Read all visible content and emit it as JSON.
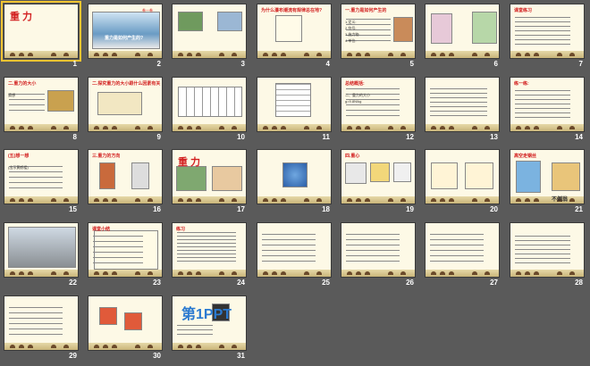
{
  "slides": [
    {
      "number": "1",
      "texts": [
        "重 力"
      ]
    },
    {
      "number": "2",
      "texts": [
        "重力是如何产生的?",
        "卷一卷"
      ]
    },
    {
      "number": "3",
      "texts": []
    },
    {
      "number": "4",
      "texts": [
        "为什么瀑布潮流有规律总在地?"
      ]
    },
    {
      "number": "5",
      "texts": [
        "一.重力是如何产生的",
        "1.定义:",
        "2.符号:",
        "3.施力物:",
        "4.单位:"
      ]
    },
    {
      "number": "6",
      "texts": []
    },
    {
      "number": "7",
      "texts": [
        "课堂练习"
      ]
    },
    {
      "number": "8",
      "texts": [
        "二.重力的大小",
        "猜想"
      ]
    },
    {
      "number": "9",
      "texts": [
        "二.探究重力的大小跟什么因素有关"
      ]
    },
    {
      "number": "10",
      "texts": []
    },
    {
      "number": "11",
      "texts": []
    },
    {
      "number": "12",
      "texts": [
        "总结概括:",
        "二、重力的大小",
        "g=9.8N/kg"
      ]
    },
    {
      "number": "13",
      "texts": []
    },
    {
      "number": "14",
      "texts": [
        "练一练:"
      ]
    },
    {
      "number": "15",
      "texts": [
        "(五)想一想",
        "(出示黄鹤楼)"
      ]
    },
    {
      "number": "16",
      "texts": [
        "三.重力的方向"
      ]
    },
    {
      "number": "17",
      "texts": [
        "重 力"
      ]
    },
    {
      "number": "18",
      "texts": []
    },
    {
      "number": "19",
      "texts": [
        "四.重心"
      ]
    },
    {
      "number": "20",
      "texts": []
    },
    {
      "number": "21",
      "texts": [
        "高空走钢丝",
        "不倒翁"
      ]
    },
    {
      "number": "22",
      "texts": []
    },
    {
      "number": "23",
      "texts": [
        "课堂小结"
      ]
    },
    {
      "number": "24",
      "texts": [
        "练习"
      ]
    },
    {
      "number": "25",
      "texts": []
    },
    {
      "number": "26",
      "texts": []
    },
    {
      "number": "27",
      "texts": []
    },
    {
      "number": "28",
      "texts": []
    },
    {
      "number": "29",
      "texts": []
    },
    {
      "number": "30",
      "texts": []
    },
    {
      "number": "31",
      "texts": [
        "第1PPT"
      ]
    }
  ],
  "selected_slide": "1"
}
